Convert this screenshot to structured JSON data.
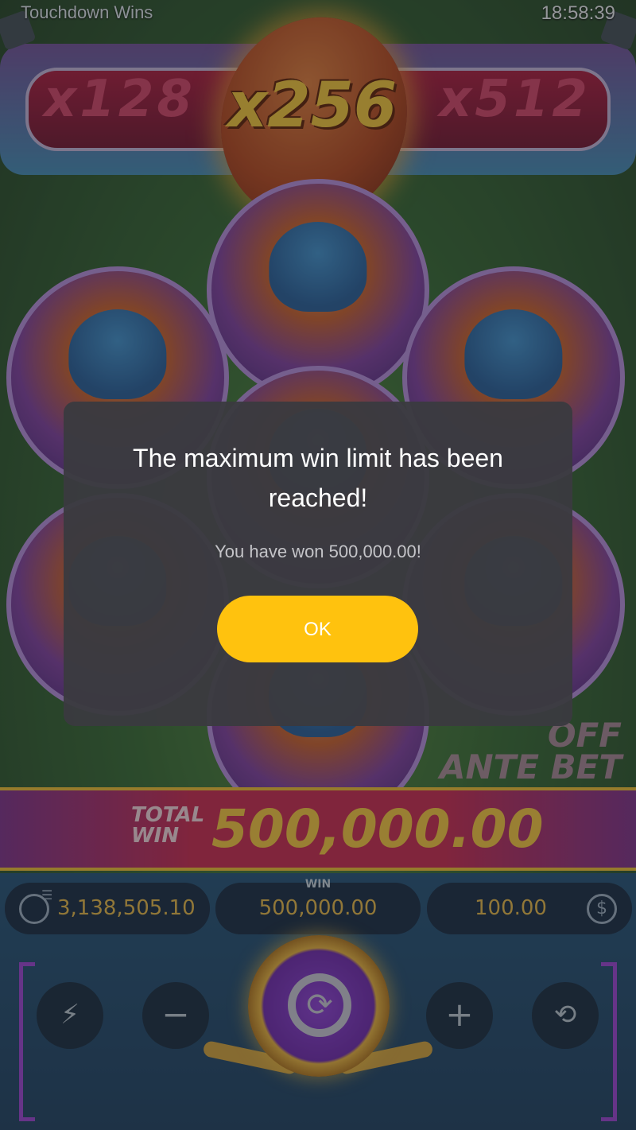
{
  "header": {
    "game_title": "Touchdown Wins",
    "clock": "18:58:39"
  },
  "multipliers": {
    "left": "x128",
    "center": "x256",
    "right": "x512"
  },
  "banner": {
    "total_win_label": "TOTAL WIN",
    "total_win_value": "500,000.00",
    "ante_bet_label": "OFF ANTE BET"
  },
  "bottom_bar": {
    "balance": "3,138,505.10",
    "win_label": "WIN",
    "win_value": "500,000.00",
    "bet_value": "100.00",
    "minus_glyph": "−",
    "plus_glyph": "+"
  },
  "dialog": {
    "title": "The maximum win limit has been reached!",
    "message": "You have won 500,000.00!",
    "ok_label": "OK"
  },
  "icons": {
    "balance": "user-icon",
    "menu": "menu-icon",
    "bet": "coin-icon",
    "turbo": "turbo-off-icon",
    "autoplay": "autoplay-icon",
    "spin": "spin-icon"
  },
  "colors": {
    "accent_yellow": "#ffc20e",
    "gold_text": "#e7b945",
    "dialog_bg": "#3a3a40"
  }
}
